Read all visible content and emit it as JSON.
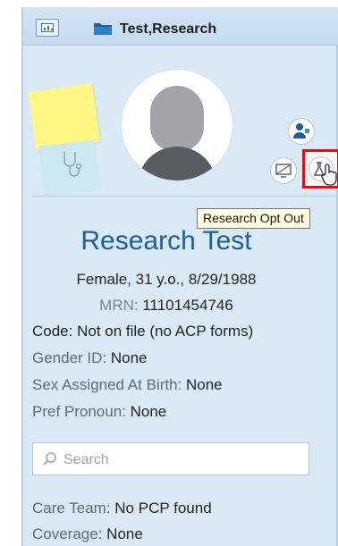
{
  "header": {
    "tab_title": "Test,Research",
    "chart_button_icon": "chart-icon",
    "folder_icon": "folder-icon"
  },
  "tooltip": {
    "text": "Research Opt Out"
  },
  "patient": {
    "name": "Research Test",
    "demographics": "Female, 31 y.o., 8/29/1988",
    "mrn_label": "MRN: ",
    "mrn_value": "11101454746",
    "code_label": "Code: ",
    "code_value": "Not on file (no ACP forms)",
    "gender_id_label": "Gender ID: ",
    "gender_id_value": "None",
    "sex_at_birth_label": "Sex Assigned At Birth: ",
    "sex_at_birth_value": "None",
    "pronoun_label": "Pref Pronoun: ",
    "pronoun_value": "None"
  },
  "search": {
    "placeholder": "Search",
    "value": ""
  },
  "care_team": {
    "label": "Care Team: ",
    "value": "No PCP found"
  },
  "coverage": {
    "label": "Coverage: ",
    "value": "None"
  },
  "colors": {
    "panel_bg": "#dae9f6",
    "name_blue": "#1c6096",
    "highlight_red": "#e01010",
    "sticky_yellow": "#fff683"
  }
}
